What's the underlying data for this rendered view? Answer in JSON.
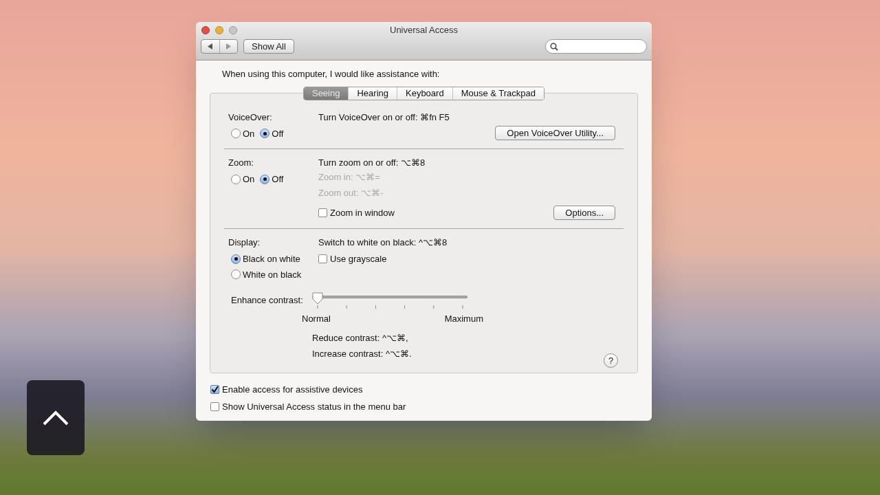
{
  "window": {
    "title": "Universal Access"
  },
  "toolbar": {
    "show_all": "Show All"
  },
  "intro": "When using this computer, I would like assistance with:",
  "tabs": [
    {
      "label": "Seeing",
      "selected": true
    },
    {
      "label": "Hearing",
      "selected": false
    },
    {
      "label": "Keyboard",
      "selected": false
    },
    {
      "label": "Mouse & Trackpad",
      "selected": false
    }
  ],
  "voiceover": {
    "label": "VoiceOver:",
    "radios": [
      {
        "label": "On",
        "selected": false
      },
      {
        "label": "Off",
        "selected": true
      }
    ],
    "shortcut": "Turn VoiceOver on or off: ⌘fn F5",
    "button": "Open VoiceOver Utility..."
  },
  "zoom": {
    "label": "Zoom:",
    "radios": [
      {
        "label": "On",
        "selected": false
      },
      {
        "label": "Off",
        "selected": true
      }
    ],
    "shortcut": "Turn zoom on or off: ⌥⌘8",
    "lines": [
      {
        "text": "Zoom in: ⌥⌘=",
        "disabled": true
      },
      {
        "text": "Zoom out: ⌥⌘-",
        "disabled": true
      }
    ],
    "checkbox": {
      "label": "Zoom in window",
      "checked": false
    },
    "button": "Options..."
  },
  "display": {
    "label": "Display:",
    "radios": [
      {
        "label": "Black on white",
        "selected": true
      },
      {
        "label": "White on black",
        "selected": false
      }
    ],
    "shortcut": "Switch to white on black: ^⌥⌘8",
    "checkbox": {
      "label": "Use grayscale",
      "checked": false
    },
    "slider": {
      "label": "Enhance contrast:",
      "level": 0,
      "min_label": "Normal",
      "max_label": "Maximum"
    },
    "lines": [
      "Reduce contrast: ^⌥⌘,",
      "Increase contrast: ^⌥⌘."
    ],
    "help": "?"
  },
  "bottom_checkboxes": [
    {
      "label": "Enable access for assistive devices",
      "checked": true
    },
    {
      "label": "Show Universal Access status in the menu bar",
      "checked": false
    }
  ]
}
